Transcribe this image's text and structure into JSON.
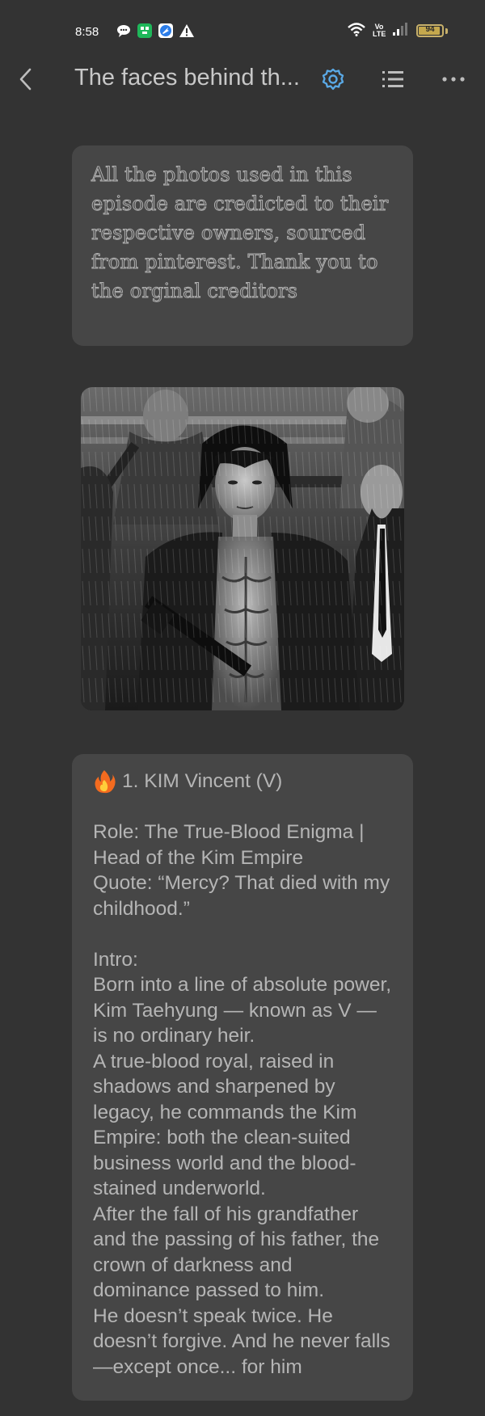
{
  "status_bar": {
    "time": "8:58",
    "battery": "94",
    "battery_level": 0.94,
    "network": "Vo LTE",
    "icons": [
      "chat-bubble-icon",
      "green-app-icon",
      "blue-app-icon",
      "warning-icon",
      "wifi-icon",
      "signal-icon",
      "battery-icon"
    ]
  },
  "app_bar": {
    "title": "The faces behind th...",
    "accent_color": "#5aa9e6"
  },
  "credit": {
    "text": "All the photos used in this episode are credicted to their respective owners, sourced from pinterest. Thank you to the orginal creditors"
  },
  "character": {
    "heading": "1. KIM Vincent (V)",
    "role": "Role: The True-Blood Enigma | Head of the Kim Empire",
    "quote": "Quote: “Mercy? That died with my childhood.”",
    "intro_label": "Intro:",
    "intro_lines": [
      "Born into a line of absolute power, Kim Taehyung — known as V — is no ordinary heir.",
      "A true-blood royal, raised in shadows and sharpened by legacy, he commands the Kim Empire: both the clean-suited business world and the blood-stained underworld.",
      "After the fall of his grandfather and the passing of his father, the crown of darkness and dominance passed to him.",
      "He doesn’t speak twice. He doesn’t forgive. And he never falls—except once... for him"
    ]
  }
}
